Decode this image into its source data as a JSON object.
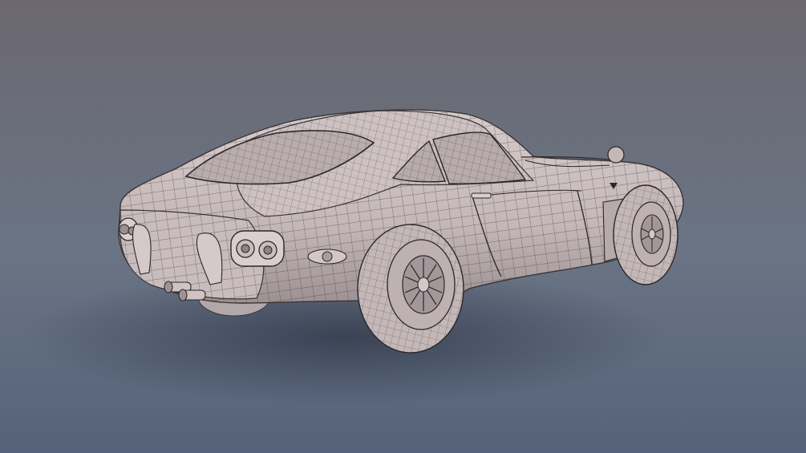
{
  "scene": {
    "subject": "wireframe-render-sports-coupe",
    "colors": {
      "background_top": "#6b6870",
      "background_mid": "#6a7484",
      "background_bottom": "#55637a",
      "body_surface": "#c9bcbd",
      "body_shadow": "#8e8486",
      "wire": "#3a3436",
      "tire": "#bfb4b5",
      "ground_shadow": "#3a4456"
    }
  }
}
